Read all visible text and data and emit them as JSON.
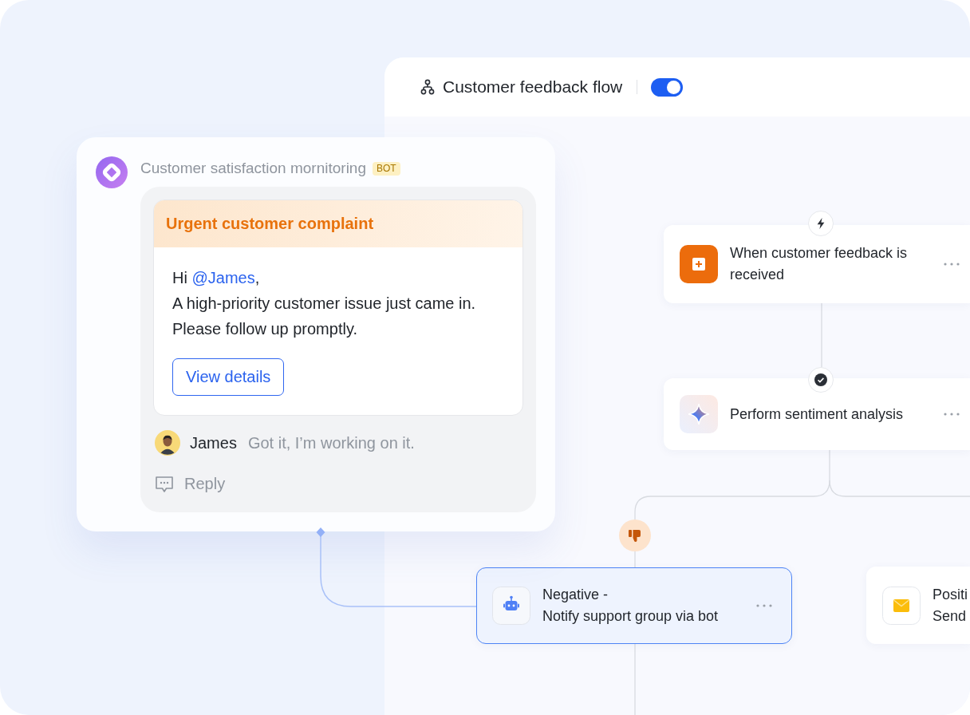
{
  "flow_header": {
    "title": "Customer feedback flow",
    "enabled": true
  },
  "notification": {
    "sender": "Customer satisfaction mornitoring",
    "sender_tag": "BOT",
    "message": {
      "title": "Urgent customer complaint",
      "greeting": {
        "prefix": "Hi",
        "mention": "@James",
        "suffix": ","
      },
      "lines": [
        "A high-priority customer issue just came in.",
        "Please follow up promptly."
      ],
      "button": "View details"
    },
    "reply": {
      "author": "James",
      "text": "Got it, I’m working on it."
    },
    "reply_action": "Reply"
  },
  "nodes": [
    {
      "kind": "trigger",
      "title": "When customer feedback is received",
      "selected": false
    },
    {
      "kind": "ai",
      "title": "Perform sentiment analysis",
      "selected": false
    },
    {
      "kind": "bot",
      "label": "Negative -",
      "title": "Notify support group via bot",
      "selected": true
    },
    {
      "kind": "email",
      "label": "Positi",
      "title": "Send",
      "selected": false
    }
  ]
}
